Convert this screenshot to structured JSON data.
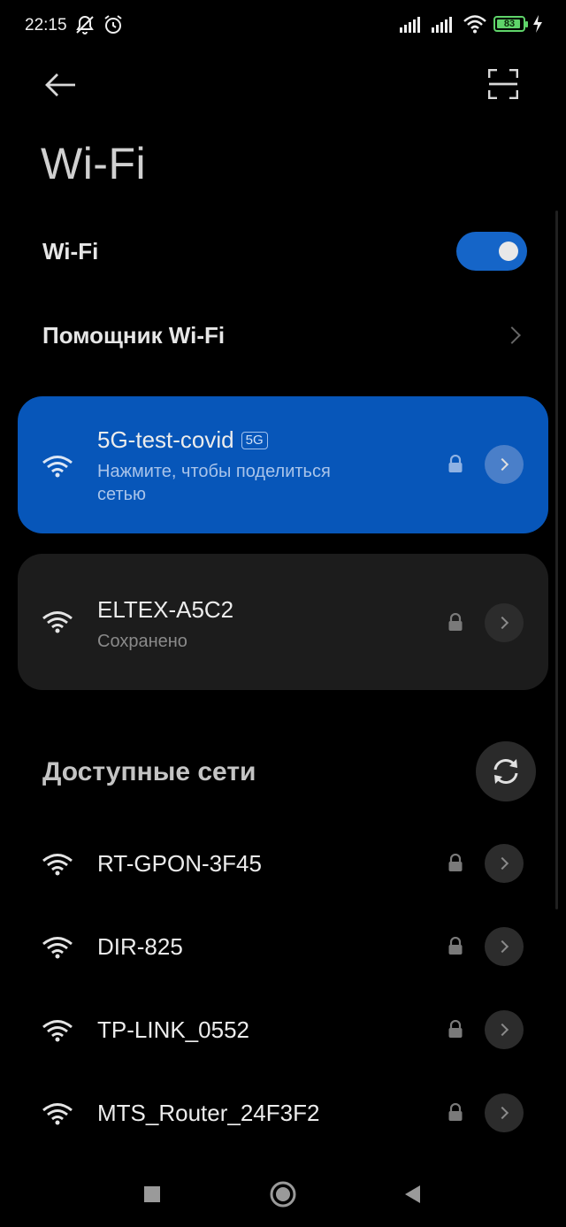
{
  "status_bar": {
    "time": "22:15",
    "left_icons": [
      "notifications-off-icon",
      "alarm-icon"
    ],
    "right_icons": [
      "signal-icon",
      "signal-icon",
      "wifi-icon",
      "battery-icon",
      "charging-icon"
    ],
    "battery_level": "83"
  },
  "header": {
    "back_icon": "back-arrow-icon",
    "scan_icon": "qr-scan-icon",
    "title": "Wi-Fi"
  },
  "wifi_toggle": {
    "label": "Wi-Fi",
    "enabled": true
  },
  "assistant": {
    "label": "Помощник Wi-Fi"
  },
  "connected_network": {
    "name": "5G-test-covid",
    "band_badge": "5G",
    "subtitle_line1": "Нажмите, чтобы поделиться",
    "subtitle_line2": "сетью",
    "locked": true
  },
  "saved_network": {
    "name": "ELTEX-A5C2",
    "subtitle": "Сохранено",
    "locked": true
  },
  "available": {
    "title": "Доступные сети",
    "refresh_icon": "refresh-icon",
    "networks": [
      {
        "name": "RT-GPON-3F45",
        "locked": true
      },
      {
        "name": "DIR-825",
        "locked": true
      },
      {
        "name": "TP-LINK_0552",
        "locked": true
      },
      {
        "name": "MTS_Router_24F3F2",
        "locked": true
      }
    ]
  },
  "nav_bar": {
    "buttons": [
      "recents-square-icon",
      "home-circle-icon",
      "back-triangle-icon"
    ]
  },
  "colors": {
    "accent": "#0756b9",
    "toggle_on": "#1565c8",
    "background": "#000000",
    "card": "#1c1c1c"
  }
}
